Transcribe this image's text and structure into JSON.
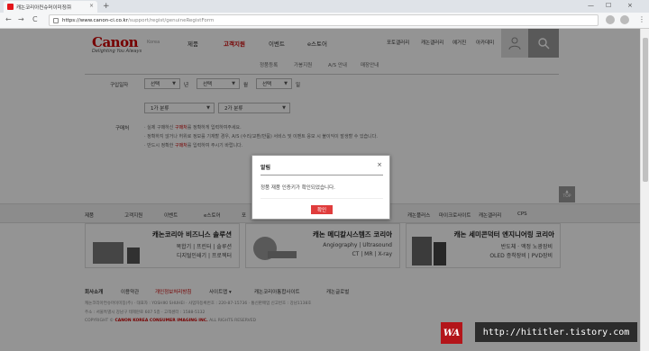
{
  "browser": {
    "tab_title": "캐논코리아컨슈머이미징㈜",
    "tab_close": "×",
    "new_tab": "+",
    "nav_back": "←",
    "nav_forward": "→",
    "nav_reload": "C",
    "url_host": "https://www.canon-ci.co.kr",
    "url_path": "/support/regist/genuineRegistForm",
    "win_min": "—",
    "win_max": "☐",
    "win_close": "×",
    "menu": "⋮"
  },
  "header": {
    "logo": "Canon",
    "tagline": "Delighting You Always",
    "region": "Korea",
    "gnb": [
      "제품",
      "고객지원",
      "이벤트",
      "e스토어"
    ],
    "util": [
      "포토갤러리",
      "캐논갤러리",
      "예거진",
      "아카데미"
    ],
    "lnb": [
      "정품등록",
      "가봉지원",
      "A/S 안내",
      "매장안내"
    ]
  },
  "form": {
    "purchase_date_label": "구입일자",
    "year_select": "선택",
    "year_unit": "년",
    "month_select": "선택",
    "month_unit": "월",
    "day_select": "선택",
    "day_unit": "일",
    "category1_select": "1가 분류",
    "category2_select": "2가 분류",
    "purchase_place_label": "구매처",
    "notes": [
      {
        "pre": "· 실제 구매하신 ",
        "em": "구매처",
        "post": "를 정확하게 입력하여주세요."
      },
      {
        "pre": "· 정확하지 않거나 허위로 정보를 기재할 경우, A/S (수리/교환/반품) 서비스 및 이벤트 응모 시 불이익이 발생할 수 있습니다.",
        "em": "",
        "post": ""
      },
      {
        "pre": "· 반드시 정확한 ",
        "em": "구매처",
        "post": "를 입력하여 주시기 바랍니다."
      }
    ]
  },
  "top_button": {
    "arrow": "▲",
    "label": "TOP"
  },
  "sitemap": [
    "제품",
    "고객지원",
    "이벤트",
    "e스토어",
    "포",
    "캐논플러스",
    "마이크로사이트",
    "캐논갤러리",
    "CPS"
  ],
  "banners": [
    {
      "title": "캐논코리아 비즈니스 솔루션",
      "lines": [
        "복합기 | 프린터 | 솔루션",
        "디지털인쇄기 | 프로젝터"
      ]
    },
    {
      "title": "캐논 메디칼시스템즈 코리아",
      "lines": [
        "Angiography | Ultrasound",
        "CT | MR | X-ray"
      ]
    },
    {
      "title": "캐논 세미콘덕터 엔지니어링 코리아",
      "lines": [
        "반도체 · 액정 노광장비",
        "OLED 증착장비 | PVD장비"
      ]
    }
  ],
  "footer": {
    "links": [
      "회사소개",
      "이용약관",
      "개인정보처리방침",
      "사이트맵",
      "캐논코리아통합사이트",
      "캐논글로벌"
    ],
    "sitemap_caret": "▾",
    "info1": "캐논코리아컨슈머이미징(주) · 대표자 : YOSHIKI SHUHEI · 사업자등록번호 : 220-87-15736 · 통신판매업 신고번호 : 강남1138호",
    "info2": "주소 : 서울특별시 강남구 테헤란로 607 5층 · 고객센터 : 1588-5132",
    "copyright_pre": "COPYRIGHT © ",
    "copyright_em": "CANON KOREA CONSUMER IMAGING INC.",
    "copyright_post": " ALL RIGHTS RESERVED"
  },
  "modal": {
    "title": "알림",
    "close": "×",
    "message": "정품 재품 인증키가 확인되었습니다.",
    "ok": "확인"
  },
  "watermark": {
    "logo": "WA",
    "url": "http://hititler.tistory.com"
  },
  "colors": {
    "brand": "#cc0000",
    "ok_button": "#e03c3c",
    "overlay": "rgba(0,0,0,0.42)"
  }
}
